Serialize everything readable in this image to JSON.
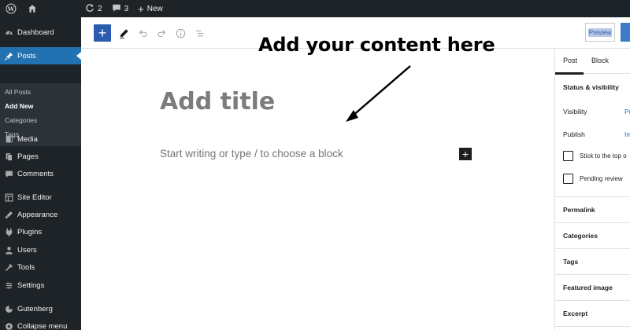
{
  "admin_bar": {
    "updates_count": "2",
    "comments_count": "3",
    "new_label": "New"
  },
  "sidebar": {
    "items": [
      {
        "label": "Dashboard",
        "icon": "dashboard-icon"
      },
      {
        "label": "Posts",
        "icon": "pin-icon",
        "current": true
      },
      {
        "label": "Media",
        "icon": "media-icon"
      },
      {
        "label": "Pages",
        "icon": "pages-icon"
      },
      {
        "label": "Comments",
        "icon": "comments-icon"
      },
      {
        "label": "Site Editor",
        "icon": "site-editor-icon"
      },
      {
        "label": "Appearance",
        "icon": "appearance-icon"
      },
      {
        "label": "Plugins",
        "icon": "plugins-icon"
      },
      {
        "label": "Users",
        "icon": "users-icon"
      },
      {
        "label": "Tools",
        "icon": "tools-icon"
      },
      {
        "label": "Settings",
        "icon": "settings-icon"
      },
      {
        "label": "Gutenberg",
        "icon": "gutenberg-icon"
      },
      {
        "label": "Collapse menu",
        "icon": "collapse-icon"
      }
    ],
    "submenu": [
      {
        "label": "All Posts"
      },
      {
        "label": "Add New",
        "active": true
      },
      {
        "label": "Categories"
      },
      {
        "label": "Tags"
      }
    ]
  },
  "toolbar": {
    "add_block": "+",
    "preview_label": "Preview"
  },
  "canvas": {
    "annotation": "Add your content here",
    "title_placeholder": "Add title",
    "block_placeholder": "Start writing or type / to choose a block",
    "inline_add": "+"
  },
  "settings": {
    "tabs": [
      "Post",
      "Block"
    ],
    "status_title": "Status & visibility",
    "visibility_label": "Visibility",
    "visibility_value": "Pu",
    "publish_label": "Publish",
    "publish_value": "Im",
    "stick_label": "Stick to the top o",
    "pending_label": "Pending review",
    "panels": [
      "Permalink",
      "Categories",
      "Tags",
      "Featured image",
      "Excerpt"
    ]
  },
  "colors": {
    "admin_bg": "#1d2327",
    "accent": "#2271b1",
    "add_button": "#2a5db0"
  }
}
